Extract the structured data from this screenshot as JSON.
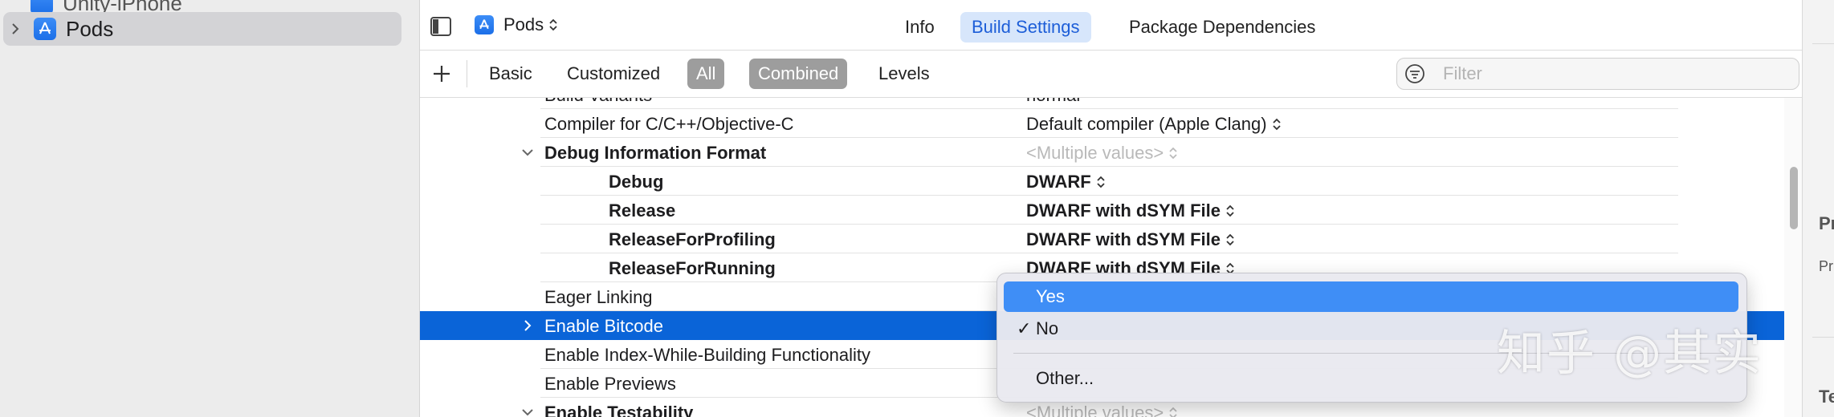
{
  "navigator": {
    "items": [
      {
        "label": "Unity-iPhone"
      },
      {
        "label": "Pods"
      }
    ]
  },
  "header": {
    "target": "Pods",
    "tabs": [
      {
        "label": "Info"
      },
      {
        "label": "Build Settings"
      },
      {
        "label": "Package Dependencies"
      }
    ]
  },
  "filter_bar": {
    "segments": [
      "Basic",
      "Customized",
      "All",
      "Combined",
      "Levels"
    ],
    "filter_placeholder": "Filter"
  },
  "settings": {
    "partial_top": {
      "name": "Build Variants",
      "value": "normal"
    },
    "compiler": {
      "name": "Compiler for C/C++/Objective-C",
      "value": "Default compiler (Apple Clang)"
    },
    "debug_info_format": {
      "name": "Debug Information Format",
      "value": "<Multiple values>"
    },
    "debug": {
      "name": "Debug",
      "value": "DWARF"
    },
    "release": {
      "name": "Release",
      "value": "DWARF with dSYM File"
    },
    "release_profiling": {
      "name": "ReleaseForProfiling",
      "value": "DWARF with dSYM File"
    },
    "release_running": {
      "name": "ReleaseForRunning",
      "value": "DWARF with dSYM File"
    },
    "eager_linking": {
      "name": "Eager Linking"
    },
    "enable_bitcode": {
      "name": "Enable Bitcode"
    },
    "index_while_building": {
      "name": "Enable Index-While-Building Functionality"
    },
    "previews": {
      "name": "Enable Previews"
    },
    "testability": {
      "name": "Enable Testability",
      "value": "<Multiple values>"
    }
  },
  "popup_menu": {
    "items": [
      {
        "label": "Yes"
      },
      {
        "label": "No",
        "check": "✓"
      },
      {
        "label": "Other..."
      }
    ]
  },
  "inspector": {
    "texts": [
      "Pr",
      "Pr",
      "Te"
    ]
  },
  "watermark": "知乎 @其实",
  "colors": {
    "selection": "#0a64d8",
    "menu_highlight": "#3f8ef6",
    "tab_active_bg": "#d7e6fb",
    "tab_active_text": "#1d5ed8"
  }
}
